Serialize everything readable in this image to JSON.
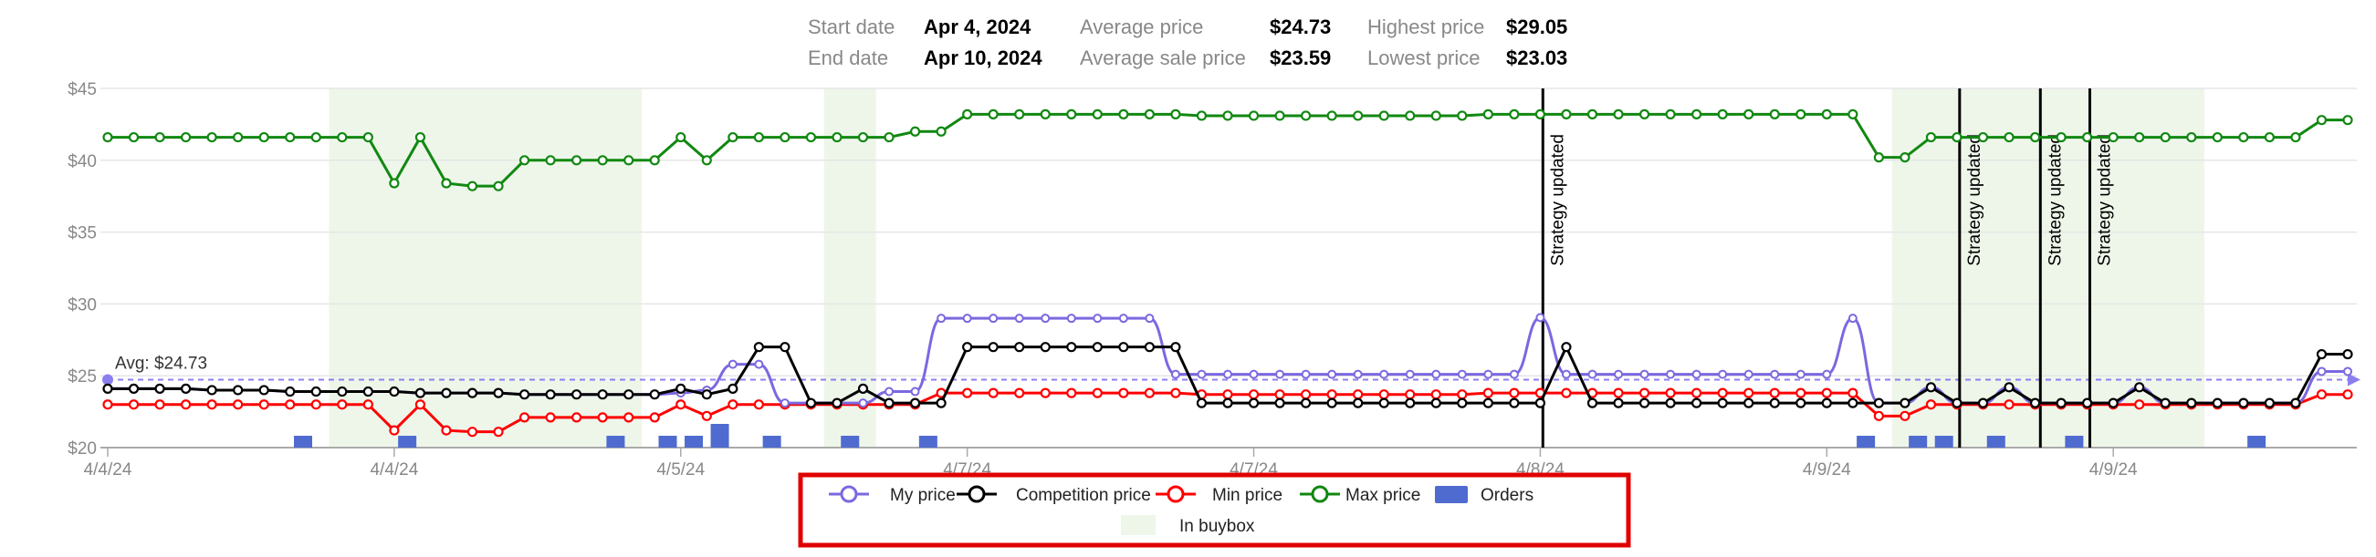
{
  "summary": {
    "start_label": "Start date",
    "start_value": "Apr 4, 2024",
    "end_label": "End date",
    "end_value": "Apr 10, 2024",
    "avg_label": "Average price",
    "avg_value": "$24.73",
    "avg_sale_label": "Average sale price",
    "avg_sale_value": "$23.59",
    "high_label": "Highest price",
    "high_value": "$29.05",
    "low_label": "Lowest price",
    "low_value": "$23.03"
  },
  "colors": {
    "my_price": "#7b68e0",
    "competition": "#000000",
    "min_price": "#ff0000",
    "max_price": "#118811",
    "orders": "#4f6bd0",
    "buybox": "#eef6ea",
    "legend_border": "#e00000",
    "avg_line": "#8b7ff0"
  },
  "chart_data": {
    "type": "line",
    "n_points": 87,
    "y_ticks": [
      "$45",
      "$40",
      "$35",
      "$30",
      "$25",
      "$20"
    ],
    "ylim": [
      20,
      45
    ],
    "x_tick_labels": [
      {
        "label": "4/4/24",
        "index": 0
      },
      {
        "label": "4/4/24",
        "index": 11
      },
      {
        "label": "4/5/24",
        "index": 22
      },
      {
        "label": "4/7/24",
        "index": 33
      },
      {
        "label": "4/7/24",
        "index": 44
      },
      {
        "label": "4/8/24",
        "index": 55
      },
      {
        "label": "4/9/24",
        "index": 66
      },
      {
        "label": "4/9/24",
        "index": 77
      }
    ],
    "average": {
      "label": "Avg: $24.73",
      "value": 24.73
    },
    "buybox_ranges": [
      [
        8.5,
        20.5
      ],
      [
        27.5,
        29.5
      ],
      [
        68.5,
        80.5
      ]
    ],
    "strategy_updates": [
      {
        "label": "Strategy updated",
        "index": 55.1
      },
      {
        "label": "Strategy updated",
        "index": 71.1
      },
      {
        "label": "Strategy updated",
        "index": 74.2
      },
      {
        "label": "Strategy updated",
        "index": 76.1
      }
    ],
    "orders": [
      {
        "index": 7.5,
        "count": 1
      },
      {
        "index": 11.5,
        "count": 1
      },
      {
        "index": 19.5,
        "count": 1
      },
      {
        "index": 21.5,
        "count": 1
      },
      {
        "index": 22.5,
        "count": 1
      },
      {
        "index": 23.5,
        "count": 2
      },
      {
        "index": 25.5,
        "count": 1
      },
      {
        "index": 28.5,
        "count": 1
      },
      {
        "index": 31.5,
        "count": 1
      },
      {
        "index": 67.5,
        "count": 1
      },
      {
        "index": 69.5,
        "count": 1
      },
      {
        "index": 70.5,
        "count": 1
      },
      {
        "index": 72.5,
        "count": 1
      },
      {
        "index": 75.5,
        "count": 1
      },
      {
        "index": 82.5,
        "count": 1
      }
    ],
    "series": [
      {
        "name": "My price",
        "key": "my_price",
        "smooth": true,
        "values": [
          24.1,
          24.1,
          24.1,
          24.1,
          24.0,
          24.0,
          24.0,
          23.9,
          23.9,
          23.9,
          23.9,
          23.9,
          23.8,
          23.8,
          23.8,
          23.8,
          23.7,
          23.7,
          23.7,
          23.7,
          23.7,
          23.7,
          23.8,
          24.0,
          25.8,
          25.8,
          23.1,
          23.1,
          23.1,
          23.1,
          23.9,
          23.9,
          29.0,
          29.0,
          29.0,
          29.0,
          29.0,
          29.0,
          29.0,
          29.0,
          29.0,
          25.1,
          25.1,
          25.1,
          25.1,
          25.1,
          25.1,
          25.1,
          25.1,
          25.1,
          25.1,
          25.1,
          25.1,
          25.1,
          25.1,
          29.05,
          25.1,
          25.1,
          25.1,
          25.1,
          25.1,
          25.1,
          25.1,
          25.1,
          25.1,
          25.1,
          25.1,
          29.0,
          23.1,
          23.1,
          24.2,
          23.1,
          23.1,
          24.2,
          23.1,
          23.1,
          23.1,
          23.1,
          24.2,
          23.1,
          23.1,
          23.1,
          23.1,
          23.1,
          23.1,
          25.3,
          25.3
        ]
      },
      {
        "name": "Competition price",
        "key": "competition",
        "smooth": false,
        "values": [
          24.1,
          24.1,
          24.1,
          24.1,
          24.0,
          24.0,
          24.0,
          23.9,
          23.9,
          23.9,
          23.9,
          23.9,
          23.8,
          23.8,
          23.8,
          23.8,
          23.7,
          23.7,
          23.7,
          23.7,
          23.7,
          23.7,
          24.1,
          23.7,
          24.1,
          27.0,
          27.0,
          23.1,
          23.1,
          24.1,
          23.1,
          23.1,
          23.1,
          27.0,
          27.0,
          27.0,
          27.0,
          27.0,
          27.0,
          27.0,
          27.0,
          27.0,
          23.1,
          23.1,
          23.1,
          23.1,
          23.1,
          23.1,
          23.1,
          23.1,
          23.1,
          23.1,
          23.1,
          23.1,
          23.1,
          23.1,
          27.0,
          23.1,
          23.1,
          23.1,
          23.1,
          23.1,
          23.1,
          23.1,
          23.1,
          23.1,
          23.1,
          23.1,
          23.1,
          23.1,
          24.2,
          23.1,
          23.1,
          24.2,
          23.1,
          23.1,
          23.1,
          23.1,
          24.2,
          23.1,
          23.1,
          23.1,
          23.1,
          23.1,
          23.1,
          26.5,
          26.5
        ]
      },
      {
        "name": "Min price",
        "key": "min_price",
        "smooth": false,
        "values": [
          23.0,
          23.0,
          23.0,
          23.0,
          23.0,
          23.0,
          23.0,
          23.0,
          23.0,
          23.0,
          23.0,
          21.2,
          23.0,
          21.2,
          21.1,
          21.1,
          22.1,
          22.1,
          22.1,
          22.1,
          22.1,
          22.1,
          23.0,
          22.2,
          23.0,
          23.0,
          23.0,
          23.0,
          23.0,
          23.0,
          23.0,
          23.0,
          23.8,
          23.8,
          23.8,
          23.8,
          23.8,
          23.8,
          23.8,
          23.8,
          23.8,
          23.8,
          23.7,
          23.7,
          23.7,
          23.7,
          23.7,
          23.7,
          23.7,
          23.7,
          23.7,
          23.7,
          23.7,
          23.8,
          23.8,
          23.8,
          23.8,
          23.8,
          23.8,
          23.8,
          23.8,
          23.8,
          23.8,
          23.8,
          23.8,
          23.8,
          23.8,
          23.8,
          22.2,
          22.2,
          23.0,
          23.0,
          23.0,
          23.0,
          23.0,
          23.0,
          23.0,
          23.0,
          23.0,
          23.0,
          23.0,
          23.0,
          23.0,
          23.0,
          23.0,
          23.7,
          23.7
        ]
      },
      {
        "name": "Max price",
        "key": "max_price",
        "smooth": false,
        "values": [
          41.6,
          41.6,
          41.6,
          41.6,
          41.6,
          41.6,
          41.6,
          41.6,
          41.6,
          41.6,
          41.6,
          38.4,
          41.6,
          38.4,
          38.2,
          38.2,
          40.0,
          40.0,
          40.0,
          40.0,
          40.0,
          40.0,
          41.6,
          40.0,
          41.6,
          41.6,
          41.6,
          41.6,
          41.6,
          41.6,
          41.6,
          42.0,
          42.0,
          43.2,
          43.2,
          43.2,
          43.2,
          43.2,
          43.2,
          43.2,
          43.2,
          43.2,
          43.1,
          43.1,
          43.1,
          43.1,
          43.1,
          43.1,
          43.1,
          43.1,
          43.1,
          43.1,
          43.1,
          43.2,
          43.2,
          43.2,
          43.2,
          43.2,
          43.2,
          43.2,
          43.2,
          43.2,
          43.2,
          43.2,
          43.2,
          43.2,
          43.2,
          43.2,
          40.2,
          40.2,
          41.6,
          41.6,
          41.6,
          41.6,
          41.6,
          41.6,
          41.6,
          41.6,
          41.6,
          41.6,
          41.6,
          41.6,
          41.6,
          41.6,
          41.6,
          42.8,
          42.8
        ]
      }
    ],
    "legend": [
      {
        "label": "My price",
        "key": "my_price",
        "kind": "line"
      },
      {
        "label": "Competition price",
        "key": "competition",
        "kind": "line"
      },
      {
        "label": "Min price",
        "key": "min_price",
        "kind": "line"
      },
      {
        "label": "Max price",
        "key": "max_price",
        "kind": "line"
      },
      {
        "label": "Orders",
        "key": "orders",
        "kind": "bar"
      },
      {
        "label": "In buybox",
        "key": "buybox",
        "kind": "area"
      }
    ]
  }
}
